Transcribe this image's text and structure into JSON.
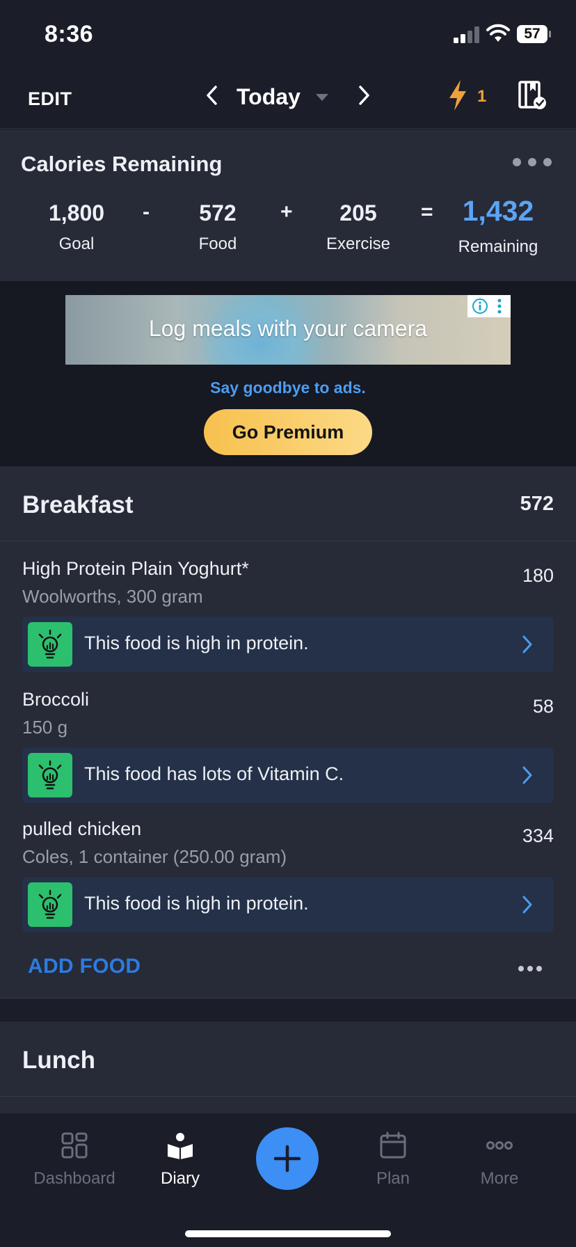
{
  "status_bar": {
    "time": "8:36",
    "battery": "57"
  },
  "nav": {
    "edit_label": "EDIT",
    "date_label": "Today",
    "streak_count": "1"
  },
  "calories": {
    "title": "Calories Remaining",
    "goal_value": "1,800",
    "goal_label": "Goal",
    "minus": "-",
    "food_value": "572",
    "food_label": "Food",
    "plus": "+",
    "exercise_value": "205",
    "exercise_label": "Exercise",
    "equals": "=",
    "remaining_value": "1,432",
    "remaining_label": "Remaining",
    "remaining_color": "#5ba4f5"
  },
  "ad": {
    "banner_text": "Log meals with your camera",
    "tagline": "Say goodbye to ads.",
    "premium_button": "Go Premium"
  },
  "breakfast": {
    "title": "Breakfast",
    "total": "572",
    "items": [
      {
        "name": "High Protein Plain Yoghurt*",
        "desc": "Woolworths, 300 gram",
        "calories": "180",
        "tip": "This food is high in protein."
      },
      {
        "name": "Broccoli",
        "desc": "150 g",
        "calories": "58",
        "tip": "This food has lots of Vitamin C."
      },
      {
        "name": "pulled chicken",
        "desc": "Coles, 1 container (250.00 gram)",
        "calories": "334",
        "tip": "This food is high in protein."
      }
    ],
    "add_food_label": "ADD FOOD"
  },
  "lunch": {
    "title": "Lunch"
  },
  "tabbar": {
    "dashboard": "Dashboard",
    "diary": "Diary",
    "plan": "Plan",
    "more": "More"
  },
  "colors": {
    "accent": "#3d8ef5",
    "tip_green": "#2cbf6e",
    "premium_gold": "#f7c14e"
  }
}
